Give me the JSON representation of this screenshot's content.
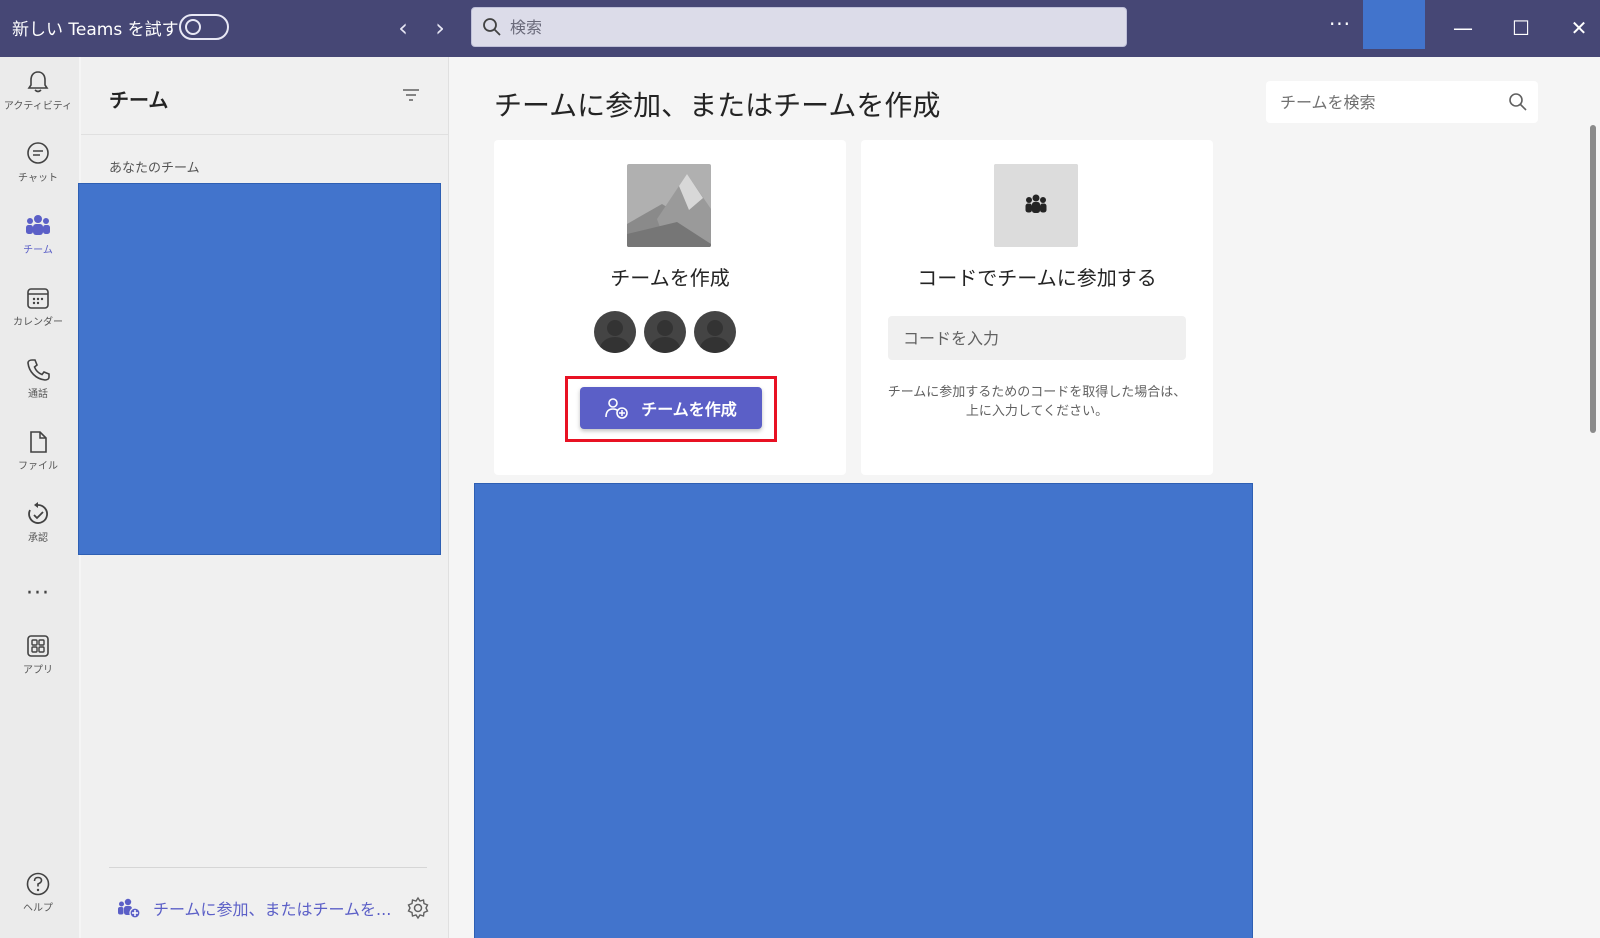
{
  "titlebar": {
    "title": "新しい Teams を試す",
    "search_placeholder": "検索",
    "back_glyph": "‹",
    "forward_glyph": "›",
    "more_glyph": "···",
    "minimize_glyph": "—",
    "maximize_glyph": "☐",
    "close_glyph": "✕"
  },
  "rail": {
    "items": [
      {
        "label": "アクティビティ",
        "icon": "bell-icon"
      },
      {
        "label": "チャット",
        "icon": "chat-icon"
      },
      {
        "label": "チーム",
        "icon": "teams-icon",
        "active": true
      },
      {
        "label": "カレンダー",
        "icon": "calendar-icon"
      },
      {
        "label": "通話",
        "icon": "phone-icon"
      },
      {
        "label": "ファイル",
        "icon": "file-icon"
      },
      {
        "label": "承認",
        "icon": "approval-icon"
      },
      {
        "label": "アプリ",
        "icon": "apps-icon"
      },
      {
        "label": "ヘルプ",
        "icon": "help-icon"
      }
    ],
    "more_glyph": "···"
  },
  "panel": {
    "title": "チーム",
    "section_label": "あなたのチーム",
    "join_link": "チームに参加、またはチームを..."
  },
  "main": {
    "title": "チームに参加、またはチームを作成",
    "search_placeholder": "チームを検索",
    "create_card": {
      "heading": "チームを作成",
      "button_label": "チームを作成"
    },
    "join_card": {
      "heading": "コードでチームに参加する",
      "code_placeholder": "コードを入力",
      "help_line1": "チームに参加するためのコードを取得した場合は、",
      "help_line2": "上に入力してください。"
    }
  },
  "colors": {
    "titlebar": "#464775",
    "accent": "#5b5fc7",
    "redacted": "#4274cc",
    "highlight": "#e81123"
  }
}
